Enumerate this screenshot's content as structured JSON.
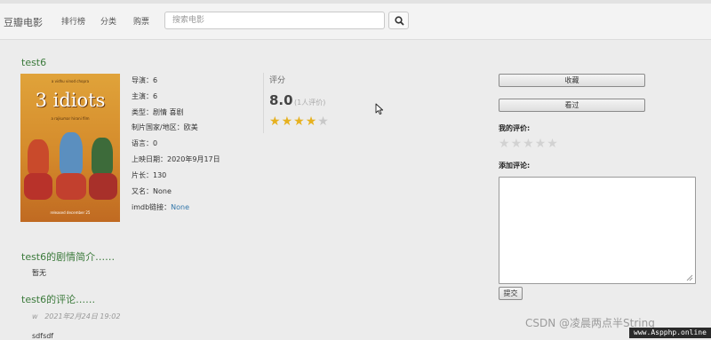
{
  "navbar": {
    "brand": "豆瓣电影",
    "links": [
      "排行榜",
      "分类",
      "购票"
    ],
    "search_placeholder": "搜索电影"
  },
  "movie": {
    "title": "test6",
    "poster": {
      "top_text": "a vidhu vinod chopra",
      "title": "3 idiots",
      "sub_text": "a rajkumar hirani film",
      "bottom_text": "released december 25"
    },
    "info": [
      {
        "label": "导演：",
        "value": "6"
      },
      {
        "label": "主演：",
        "value": "6"
      },
      {
        "label": "类型：",
        "value": "剧情 喜剧"
      },
      {
        "label": "制片国家/地区：",
        "value": "欧美"
      },
      {
        "label": "语言：",
        "value": "0"
      },
      {
        "label": "上映日期：",
        "value": "2020年9月17日"
      },
      {
        "label": "片长：",
        "value": "130"
      },
      {
        "label": "又名：",
        "value": "None"
      },
      {
        "label": "imdb链接：",
        "value": "None"
      }
    ]
  },
  "rating": {
    "label": "评分",
    "score": "8.0",
    "count": "(1人评价)",
    "stars": 4,
    "max_stars": 5
  },
  "actions": {
    "collect_label": "收藏",
    "watched_label": "看过",
    "my_rating_label": "我的评价:",
    "my_rating_stars": 0,
    "add_comment_label": "添加评论:",
    "submit_label": "提交"
  },
  "sections": {
    "plot_heading": "test6的剧情简介……",
    "plot_text": "暂无",
    "comments_heading": "test6的评论……",
    "comments": [
      {
        "author": "w",
        "time": "2021年2月24日 19:02",
        "text": "sdfsdf"
      }
    ]
  },
  "watermark": {
    "text": "CSDN @凌晨两点半String",
    "site": "www.Aspphp.online"
  },
  "colors": {
    "heading_green": "#3b7a3b",
    "star_gold": "#e6b11f",
    "link_blue": "#3377aa"
  }
}
